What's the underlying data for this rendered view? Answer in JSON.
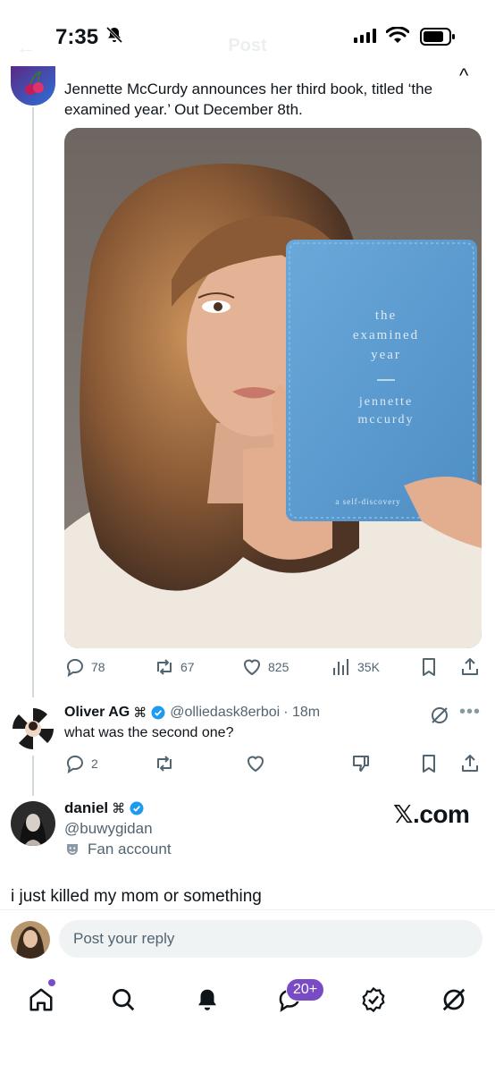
{
  "status_bar": {
    "time": "7:35"
  },
  "header": {
    "title": "Post"
  },
  "main_post": {
    "text": "Jennette McCurdy announces her third book, titled ‘the examined year.’ Out December 8th.",
    "image": {
      "book_title_lines": [
        "the",
        "examined",
        "year"
      ],
      "book_author_lines": [
        "jennette",
        "mccurdy"
      ],
      "book_tagline": "a self-discovery"
    },
    "actions": {
      "replies": "78",
      "reposts": "67",
      "likes": "825",
      "views": "35K"
    }
  },
  "reply_1": {
    "name": "Oliver AG",
    "handle": "@olliedask8erboi",
    "time": "· 18m",
    "text": "what was the second one?",
    "actions": {
      "replies": "2"
    }
  },
  "reply_2": {
    "name": "daniel",
    "handle": "@buwygidan",
    "fan_label": "Fan account",
    "watermark": "𝕏.com",
    "caption": "i just killed my mom or something"
  },
  "composer": {
    "placeholder": "Post your reply"
  },
  "bottom_nav": {
    "messages_badge": "20+"
  },
  "colors": {
    "accent": "#1d9bf0",
    "purple": "#794bc4",
    "book_blue": "#5d9bd0"
  }
}
